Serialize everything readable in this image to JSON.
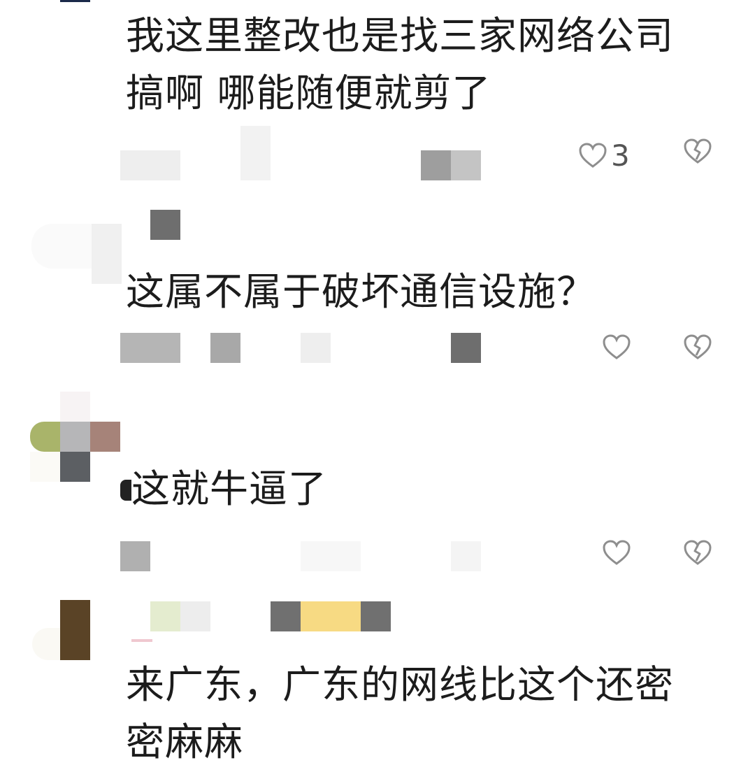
{
  "comments": [
    {
      "text_lines": [
        "我这里整改也是找三家网络公司",
        "搞啊 哪能随便就剪了"
      ],
      "like_count": "3",
      "like_icon": "heart-outline-icon",
      "dislike_icon": "broken-heart-icon"
    },
    {
      "text_lines": [
        "这属不属于破坏通信设施？"
      ],
      "like_count": "",
      "like_icon": "heart-outline-icon",
      "dislike_icon": "broken-heart-icon"
    },
    {
      "text_lines": [
        "这就牛逼了"
      ],
      "like_count": "",
      "like_icon": "heart-outline-icon",
      "dislike_icon": "broken-heart-icon"
    },
    {
      "text_lines": [
        "来广东，广东的网线比这个还密",
        "密麻麻"
      ],
      "like_count": "",
      "like_icon": "heart-outline-icon",
      "dislike_icon": "broken-heart-icon"
    }
  ]
}
